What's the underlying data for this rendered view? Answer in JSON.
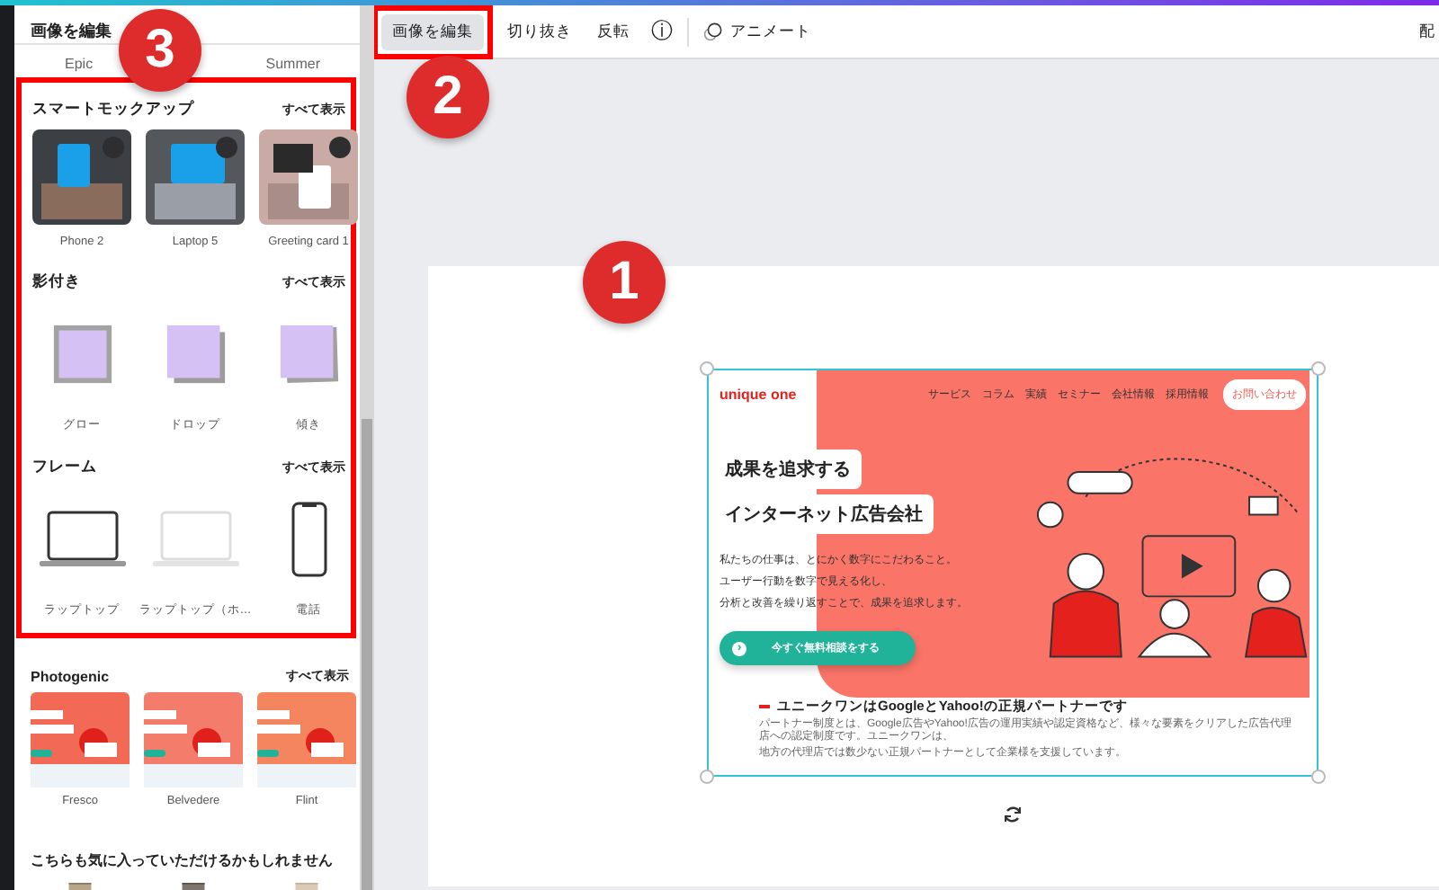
{
  "toolbar": {
    "buttons": [
      {
        "label": "画像を編集",
        "selected": true
      },
      {
        "label": "切り抜き",
        "selected": false
      },
      {
        "label": "反転",
        "selected": false
      }
    ],
    "info_icon": "ⓘ",
    "animate": "アニメート",
    "right_cut": "配"
  },
  "panel": {
    "title": "画像を編集",
    "tabs": [
      "Epic",
      "Summer"
    ],
    "highlighted_sections": [
      {
        "title": "スマートモックアップ",
        "see_all": "すべて表示",
        "items": [
          {
            "label": "Phone 2",
            "kind": "picture"
          },
          {
            "label": "Laptop 5",
            "kind": "picture"
          },
          {
            "label": "Greeting card 1",
            "kind": "picture"
          }
        ]
      },
      {
        "title": "影付き",
        "see_all": "すべて表示",
        "items": [
          {
            "label": "グロー",
            "kind": "glow"
          },
          {
            "label": "ドロップ",
            "kind": "drop"
          },
          {
            "label": "傾き",
            "kind": "tilt"
          }
        ]
      },
      {
        "title": "フレーム",
        "see_all": "すべて表示",
        "items": [
          {
            "label": "ラップトップ",
            "kind": "laptop"
          },
          {
            "label": "ラップトップ（ホ…",
            "kind": "laptop-light"
          },
          {
            "label": "電話",
            "kind": "phone"
          }
        ]
      }
    ],
    "sections": [
      {
        "title": "Photogenic",
        "see_all": "すべて表示",
        "items": [
          {
            "label": "Fresco",
            "kind": "picture"
          },
          {
            "label": "Belvedere",
            "kind": "picture"
          },
          {
            "label": "Flint",
            "kind": "picture"
          }
        ]
      },
      {
        "title": "こちらも気に入っていただけるかもしれません"
      }
    ]
  },
  "design": {
    "logo": "unique one",
    "nav": [
      "サービス",
      "コラム",
      "実績",
      "セミナー",
      "会社情報",
      "採用情報"
    ],
    "contact": "お問い合わせ",
    "headline": [
      "成果を追求する",
      "インターネット広告会社"
    ],
    "body": [
      "私たちの仕事は、とにかく数字にこだわること。",
      "ユーザー行動を数字で見える化し、",
      "分析と改善を繰り返すことで、成果を追求します。"
    ],
    "cta_icon": "›",
    "cta": "今すぐ無料相談をする",
    "partner_title": "ユニークワンはGoogleとYahoo!の正規パートナーです",
    "partner_text": [
      "パートナー制度とは、Google広告やYahoo!広告の運用実績や認定資格など、様々な要素をクリアした広告代理店への認定制度です。ユニークワンは、",
      "地方の代理店では数少ない正規パートナーとして企業様を支援しています。"
    ]
  },
  "annotations": [
    "3",
    "2",
    "1"
  ]
}
